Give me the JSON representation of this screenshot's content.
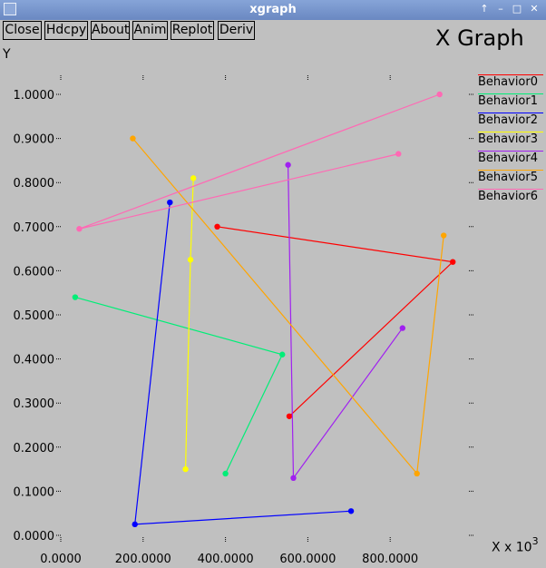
{
  "window": {
    "title": "xgraph"
  },
  "window_controls": [
    "↑",
    "–",
    "□",
    "✕"
  ],
  "toolbar": {
    "close": "Close",
    "hdcpy": "Hdcpy",
    "about": "About",
    "anim": "Anim",
    "replot": "Replot",
    "deriv": "Deriv"
  },
  "colors": {
    "background": "#c0c0c0",
    "titlebar": "#7895cc",
    "series": [
      "#ff0000",
      "#00ee77",
      "#0000ff",
      "#ffff00",
      "#a020f0",
      "#ffa500",
      "#ff69b4"
    ]
  },
  "chart_data": {
    "type": "line",
    "title": "X Graph",
    "ylabel": "Y",
    "xlabel": "X x 10",
    "xlabel_exponent": "3",
    "xlim": [
      0,
      1000
    ],
    "ylim": [
      0,
      1.0
    ],
    "x_ticks": [
      "0.0000",
      "200.0000",
      "400.0000",
      "600.0000",
      "800.0000"
    ],
    "y_ticks": [
      "0.0000",
      "0.1000",
      "0.2000",
      "0.3000",
      "0.4000",
      "0.5000",
      "0.6000",
      "0.7000",
      "0.8000",
      "0.9000",
      "1.0000"
    ],
    "legend_position": "right",
    "series": [
      {
        "name": "Behavior0",
        "points": [
          [
            380,
            0.7
          ],
          [
            952,
            0.62
          ],
          [
            555,
            0.27
          ]
        ]
      },
      {
        "name": "Behavior1",
        "points": [
          [
            35,
            0.54
          ],
          [
            538,
            0.41
          ],
          [
            400,
            0.14
          ]
        ]
      },
      {
        "name": "Behavior2",
        "points": [
          [
            265,
            0.755
          ],
          [
            180,
            0.025
          ],
          [
            705,
            0.055
          ]
        ]
      },
      {
        "name": "Behavior3",
        "points": [
          [
            322,
            0.81
          ],
          [
            315,
            0.625
          ],
          [
            303,
            0.15
          ]
        ]
      },
      {
        "name": "Behavior4",
        "points": [
          [
            552,
            0.84
          ],
          [
            565,
            0.13
          ],
          [
            830,
            0.47
          ]
        ]
      },
      {
        "name": "Behavior5",
        "points": [
          [
            175,
            0.9
          ],
          [
            865,
            0.14
          ],
          [
            930,
            0.68
          ]
        ]
      },
      {
        "name": "Behavior6",
        "points": [
          [
            920,
            1.0
          ],
          [
            45,
            0.695
          ],
          [
            820,
            0.865
          ]
        ]
      }
    ]
  }
}
